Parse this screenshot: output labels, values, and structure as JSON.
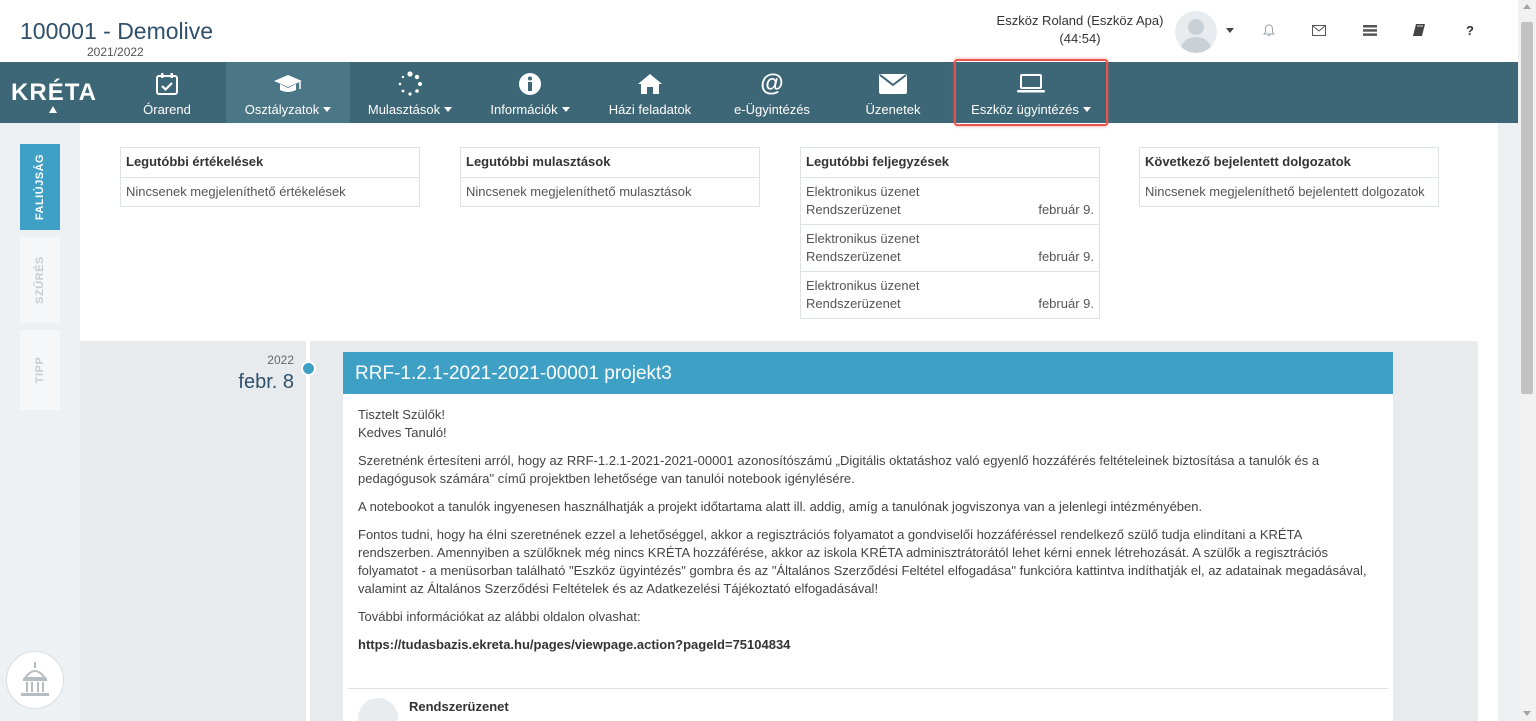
{
  "header": {
    "title": "100001 - Demolive",
    "school_year": "2021/2022",
    "user_name": "Eszköz Roland (Eszköz Apa)",
    "session_timer": "(44:54)",
    "help_label": "?"
  },
  "nav": {
    "logo": "KRÉTA",
    "items": [
      {
        "label": "Órarend",
        "icon": "calendar-check-icon",
        "dropdown": false
      },
      {
        "label": "Osztályzatok",
        "icon": "graduation-cap-icon",
        "dropdown": true
      },
      {
        "label": "Mulasztások",
        "icon": "spinner-icon",
        "dropdown": true
      },
      {
        "label": "Információk",
        "icon": "info-circle-icon",
        "dropdown": true
      },
      {
        "label": "Házi feladatok",
        "icon": "home-icon",
        "dropdown": false
      },
      {
        "label": "e-Ügyintézés",
        "icon": "at-icon",
        "dropdown": false
      },
      {
        "label": "Üzenetek",
        "icon": "envelope-icon",
        "dropdown": false
      },
      {
        "label": "Eszköz ügyintézés",
        "icon": "laptop-icon",
        "dropdown": true
      }
    ],
    "active_index": 1,
    "highlighted_index": 7
  },
  "side_tabs": [
    {
      "label": "FALIÚJSÁG",
      "active": true
    },
    {
      "label": "SZŰRÉS",
      "active": false
    },
    {
      "label": "TIPP",
      "active": false
    }
  ],
  "cards": {
    "grades": {
      "title": "Legutóbbi értékelések",
      "empty": "Nincsenek megjeleníthető értékelések"
    },
    "absences": {
      "title": "Legutóbbi mulasztások",
      "empty": "Nincsenek megjeleníthető mulasztások"
    },
    "notes": {
      "title": "Legutóbbi feljegyzések",
      "rows": [
        {
          "type": "Elektronikus üzenet",
          "sender": "Rendszerüzenet",
          "date": "február 9."
        },
        {
          "type": "Elektronikus üzenet",
          "sender": "Rendszerüzenet",
          "date": "február 9."
        },
        {
          "type": "Elektronikus üzenet",
          "sender": "Rendszerüzenet",
          "date": "február 9."
        }
      ]
    },
    "tests": {
      "title": "Következő bejelentett dolgozatok",
      "empty": "Nincsenek megjeleníthető bejelentett dolgozatok"
    }
  },
  "timeline": {
    "year": "2022",
    "day": "febr. 8"
  },
  "post": {
    "title": "RRF-1.2.1-2021-2021-00001 projekt3",
    "greeting1": "Tisztelt Szülők!",
    "greeting2": "Kedves Tanuló!",
    "para1": "Szeretnénk értesíteni arról, hogy az RRF-1.2.1-2021-2021-00001 azonosítószámú „Digitális oktatáshoz való egyenlő hozzáférés feltételeinek biztosítása a tanulók és a pedagógusok számára\" című projektben lehetősége van tanulói notebook igénylésére.",
    "para2": "A notebookot a tanulók ingyenesen használhatják a projekt időtartama alatt ill. addig, amíg a tanulónak jogviszonya van a jelenlegi intézményében.",
    "para3": "Fontos tudni, hogy ha élni szeretnének ezzel a lehetőséggel, akkor a regisztrációs folyamatot a gondviselői hozzáféréssel rendelkező szülő tudja elindítani a KRÉTA rendszerben. Amennyiben a szülőknek még nincs KRÉTA hozzáférése, akkor az iskola KRÉTA adminisztrátorától lehet kérni ennek létrehozását. A szülők a regisztrációs folyamatot - a menüsorban található \"Eszköz ügyintézés\" gombra és az \"Általános Szerződési Feltétel elfogadása\" funkcióra kattintva indíthatják el, az adatainak megadásával, valamint az Általános Szerződési Feltételek és az Adatkezelési Tájékoztató elfogadásával!",
    "para4": "További információkat az alábbi oldalon olvashat:",
    "link": "https://tudasbazis.ekreta.hu/pages/viewpage.action?pageId=75104834",
    "comment_author": "Rendszerüzenet"
  },
  "colors": {
    "navbar": "#3d6776",
    "accent": "#3fa0c6",
    "highlight": "#e8554e"
  }
}
